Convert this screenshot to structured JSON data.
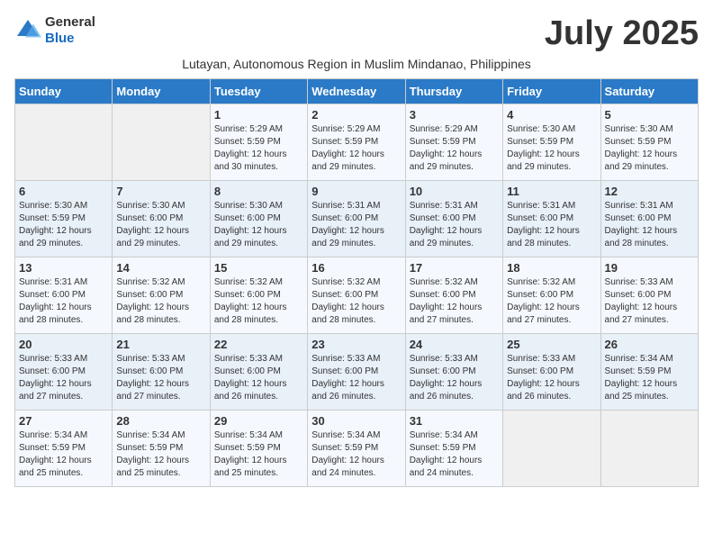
{
  "header": {
    "logo_line1": "General",
    "logo_line2": "Blue",
    "month_year": "July 2025",
    "location": "Lutayan, Autonomous Region in Muslim Mindanao, Philippines"
  },
  "weekdays": [
    "Sunday",
    "Monday",
    "Tuesday",
    "Wednesday",
    "Thursday",
    "Friday",
    "Saturday"
  ],
  "weeks": [
    [
      {
        "day": "",
        "sunrise": "",
        "sunset": "",
        "daylight": ""
      },
      {
        "day": "",
        "sunrise": "",
        "sunset": "",
        "daylight": ""
      },
      {
        "day": "1",
        "sunrise": "Sunrise: 5:29 AM",
        "sunset": "Sunset: 5:59 PM",
        "daylight": "Daylight: 12 hours and 30 minutes."
      },
      {
        "day": "2",
        "sunrise": "Sunrise: 5:29 AM",
        "sunset": "Sunset: 5:59 PM",
        "daylight": "Daylight: 12 hours and 29 minutes."
      },
      {
        "day": "3",
        "sunrise": "Sunrise: 5:29 AM",
        "sunset": "Sunset: 5:59 PM",
        "daylight": "Daylight: 12 hours and 29 minutes."
      },
      {
        "day": "4",
        "sunrise": "Sunrise: 5:30 AM",
        "sunset": "Sunset: 5:59 PM",
        "daylight": "Daylight: 12 hours and 29 minutes."
      },
      {
        "day": "5",
        "sunrise": "Sunrise: 5:30 AM",
        "sunset": "Sunset: 5:59 PM",
        "daylight": "Daylight: 12 hours and 29 minutes."
      }
    ],
    [
      {
        "day": "6",
        "sunrise": "Sunrise: 5:30 AM",
        "sunset": "Sunset: 5:59 PM",
        "daylight": "Daylight: 12 hours and 29 minutes."
      },
      {
        "day": "7",
        "sunrise": "Sunrise: 5:30 AM",
        "sunset": "Sunset: 6:00 PM",
        "daylight": "Daylight: 12 hours and 29 minutes."
      },
      {
        "day": "8",
        "sunrise": "Sunrise: 5:30 AM",
        "sunset": "Sunset: 6:00 PM",
        "daylight": "Daylight: 12 hours and 29 minutes."
      },
      {
        "day": "9",
        "sunrise": "Sunrise: 5:31 AM",
        "sunset": "Sunset: 6:00 PM",
        "daylight": "Daylight: 12 hours and 29 minutes."
      },
      {
        "day": "10",
        "sunrise": "Sunrise: 5:31 AM",
        "sunset": "Sunset: 6:00 PM",
        "daylight": "Daylight: 12 hours and 29 minutes."
      },
      {
        "day": "11",
        "sunrise": "Sunrise: 5:31 AM",
        "sunset": "Sunset: 6:00 PM",
        "daylight": "Daylight: 12 hours and 28 minutes."
      },
      {
        "day": "12",
        "sunrise": "Sunrise: 5:31 AM",
        "sunset": "Sunset: 6:00 PM",
        "daylight": "Daylight: 12 hours and 28 minutes."
      }
    ],
    [
      {
        "day": "13",
        "sunrise": "Sunrise: 5:31 AM",
        "sunset": "Sunset: 6:00 PM",
        "daylight": "Daylight: 12 hours and 28 minutes."
      },
      {
        "day": "14",
        "sunrise": "Sunrise: 5:32 AM",
        "sunset": "Sunset: 6:00 PM",
        "daylight": "Daylight: 12 hours and 28 minutes."
      },
      {
        "day": "15",
        "sunrise": "Sunrise: 5:32 AM",
        "sunset": "Sunset: 6:00 PM",
        "daylight": "Daylight: 12 hours and 28 minutes."
      },
      {
        "day": "16",
        "sunrise": "Sunrise: 5:32 AM",
        "sunset": "Sunset: 6:00 PM",
        "daylight": "Daylight: 12 hours and 28 minutes."
      },
      {
        "day": "17",
        "sunrise": "Sunrise: 5:32 AM",
        "sunset": "Sunset: 6:00 PM",
        "daylight": "Daylight: 12 hours and 27 minutes."
      },
      {
        "day": "18",
        "sunrise": "Sunrise: 5:32 AM",
        "sunset": "Sunset: 6:00 PM",
        "daylight": "Daylight: 12 hours and 27 minutes."
      },
      {
        "day": "19",
        "sunrise": "Sunrise: 5:33 AM",
        "sunset": "Sunset: 6:00 PM",
        "daylight": "Daylight: 12 hours and 27 minutes."
      }
    ],
    [
      {
        "day": "20",
        "sunrise": "Sunrise: 5:33 AM",
        "sunset": "Sunset: 6:00 PM",
        "daylight": "Daylight: 12 hours and 27 minutes."
      },
      {
        "day": "21",
        "sunrise": "Sunrise: 5:33 AM",
        "sunset": "Sunset: 6:00 PM",
        "daylight": "Daylight: 12 hours and 27 minutes."
      },
      {
        "day": "22",
        "sunrise": "Sunrise: 5:33 AM",
        "sunset": "Sunset: 6:00 PM",
        "daylight": "Daylight: 12 hours and 26 minutes."
      },
      {
        "day": "23",
        "sunrise": "Sunrise: 5:33 AM",
        "sunset": "Sunset: 6:00 PM",
        "daylight": "Daylight: 12 hours and 26 minutes."
      },
      {
        "day": "24",
        "sunrise": "Sunrise: 5:33 AM",
        "sunset": "Sunset: 6:00 PM",
        "daylight": "Daylight: 12 hours and 26 minutes."
      },
      {
        "day": "25",
        "sunrise": "Sunrise: 5:33 AM",
        "sunset": "Sunset: 6:00 PM",
        "daylight": "Daylight: 12 hours and 26 minutes."
      },
      {
        "day": "26",
        "sunrise": "Sunrise: 5:34 AM",
        "sunset": "Sunset: 5:59 PM",
        "daylight": "Daylight: 12 hours and 25 minutes."
      }
    ],
    [
      {
        "day": "27",
        "sunrise": "Sunrise: 5:34 AM",
        "sunset": "Sunset: 5:59 PM",
        "daylight": "Daylight: 12 hours and 25 minutes."
      },
      {
        "day": "28",
        "sunrise": "Sunrise: 5:34 AM",
        "sunset": "Sunset: 5:59 PM",
        "daylight": "Daylight: 12 hours and 25 minutes."
      },
      {
        "day": "29",
        "sunrise": "Sunrise: 5:34 AM",
        "sunset": "Sunset: 5:59 PM",
        "daylight": "Daylight: 12 hours and 25 minutes."
      },
      {
        "day": "30",
        "sunrise": "Sunrise: 5:34 AM",
        "sunset": "Sunset: 5:59 PM",
        "daylight": "Daylight: 12 hours and 24 minutes."
      },
      {
        "day": "31",
        "sunrise": "Sunrise: 5:34 AM",
        "sunset": "Sunset: 5:59 PM",
        "daylight": "Daylight: 12 hours and 24 minutes."
      },
      {
        "day": "",
        "sunrise": "",
        "sunset": "",
        "daylight": ""
      },
      {
        "day": "",
        "sunrise": "",
        "sunset": "",
        "daylight": ""
      }
    ]
  ]
}
